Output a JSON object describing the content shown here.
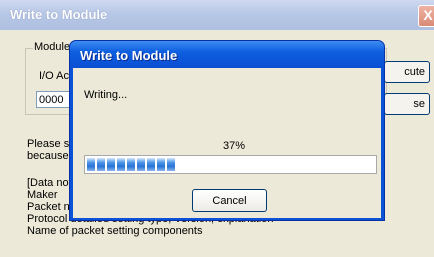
{
  "background_window": {
    "title": "Write to Module",
    "close_glyph": "X",
    "group_label": "Module",
    "io_label": "I/O Ac",
    "io_value": "0000",
    "execute_fragment": "cute",
    "close_fragment": "se",
    "notes": [
      "Please sa",
      "because"
    ],
    "details": [
      "[Data not",
      "Maker",
      "Packet n",
      "Protocol detailed setting type, Version, explanation",
      "Name of packet setting components"
    ]
  },
  "dialog": {
    "title": "Write to Module",
    "status": "Writing...",
    "progress": {
      "percent_text": "37%",
      "value": 0.37,
      "segments": 9
    },
    "cancel_label": "Cancel",
    "colors": {
      "title_bar": "#0a4fd3",
      "progress_block": "#2a73d6"
    }
  }
}
